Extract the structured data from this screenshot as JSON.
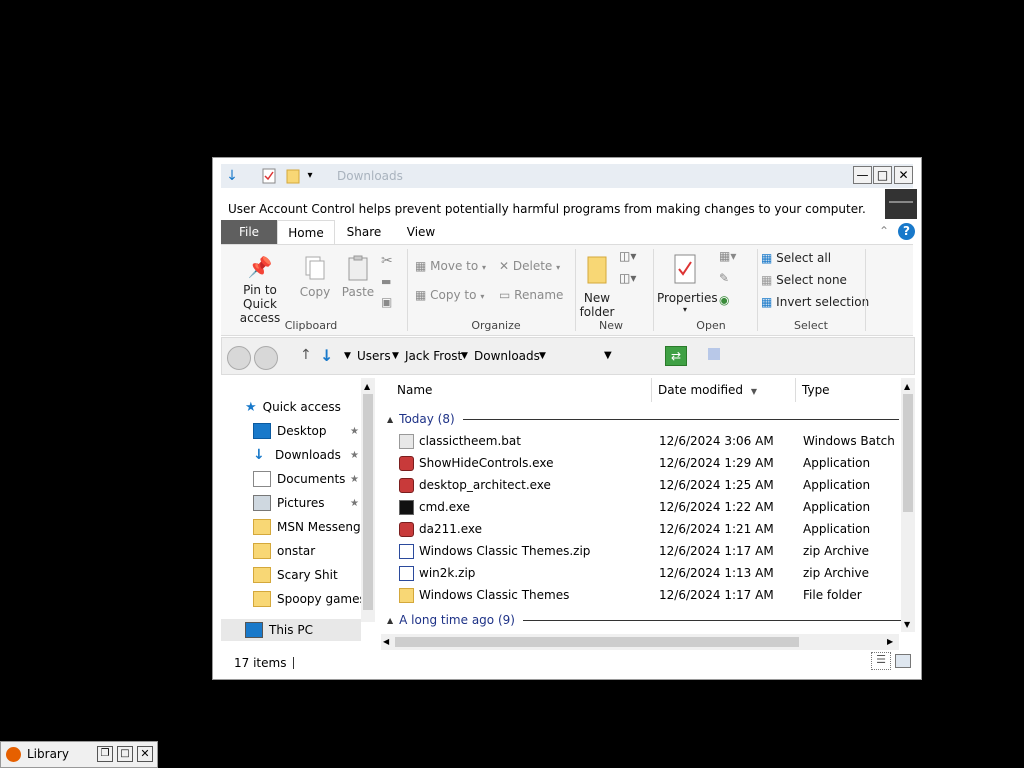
{
  "window": {
    "title": "Downloads",
    "uac_message": "User Account Control helps prevent potentially harmful programs from making changes to your computer."
  },
  "ribbon_tabs": [
    "File",
    "Home",
    "Share",
    "View"
  ],
  "ribbon": {
    "clipboard": {
      "pin_label_1": "Pin to Quick",
      "pin_label_2": "access",
      "copy": "Copy",
      "paste": "Paste",
      "group": "Clipboard"
    },
    "organize": {
      "move_to": "Move to",
      "copy_to": "Copy to",
      "delete": "Delete",
      "rename": "Rename",
      "group": "Organize"
    },
    "new": {
      "new_folder_1": "New",
      "new_folder_2": "folder",
      "group": "New"
    },
    "open": {
      "properties": "Properties",
      "group": "Open"
    },
    "select": {
      "select_all": "Select all",
      "select_none": "Select none",
      "invert": "Invert selection",
      "group": "Select"
    }
  },
  "address": {
    "crumbs": [
      "Users",
      "Jack Frost",
      "Downloads"
    ]
  },
  "nav": {
    "quick_access": "Quick access",
    "items": [
      "Desktop",
      "Downloads",
      "Documents",
      "Pictures",
      "MSN Messenger",
      "onstar",
      "Scary Shit",
      "Spoopy games"
    ],
    "this_pc": "This PC"
  },
  "columns": {
    "name": "Name",
    "date": "Date modified",
    "type": "Type"
  },
  "groups": {
    "today": "Today (8)",
    "older": "A long time ago (9)"
  },
  "files": [
    {
      "name": "classictheem.bat",
      "date": "12/6/2024 3:06 AM",
      "type": "Windows Batch Fil",
      "icon": "batch-file-icon"
    },
    {
      "name": "ShowHideControls.exe",
      "date": "12/6/2024 1:29 AM",
      "type": "Application",
      "icon": "app-icon"
    },
    {
      "name": "desktop_architect.exe",
      "date": "12/6/2024 1:25 AM",
      "type": "Application",
      "icon": "app-icon"
    },
    {
      "name": "cmd.exe",
      "date": "12/6/2024 1:22 AM",
      "type": "Application",
      "icon": "cmd-icon"
    },
    {
      "name": "da211.exe",
      "date": "12/6/2024 1:21 AM",
      "type": "Application",
      "icon": "app-icon"
    },
    {
      "name": "Windows Classic Themes.zip",
      "date": "12/6/2024 1:17 AM",
      "type": "zip Archive",
      "icon": "zip-icon"
    },
    {
      "name": "win2k.zip",
      "date": "12/6/2024 1:13 AM",
      "type": "zip Archive",
      "icon": "zip-icon"
    },
    {
      "name": "Windows Classic Themes",
      "date": "12/6/2024 1:17 AM",
      "type": "File folder",
      "icon": "folder-icon"
    }
  ],
  "status": {
    "count": "17 items"
  },
  "taskbar": {
    "library": "Library"
  },
  "colors": {
    "accent": "#1979ca",
    "file_tab": "#5f5f5f",
    "group_header": "#1e3287",
    "folder": "#f8d775"
  }
}
